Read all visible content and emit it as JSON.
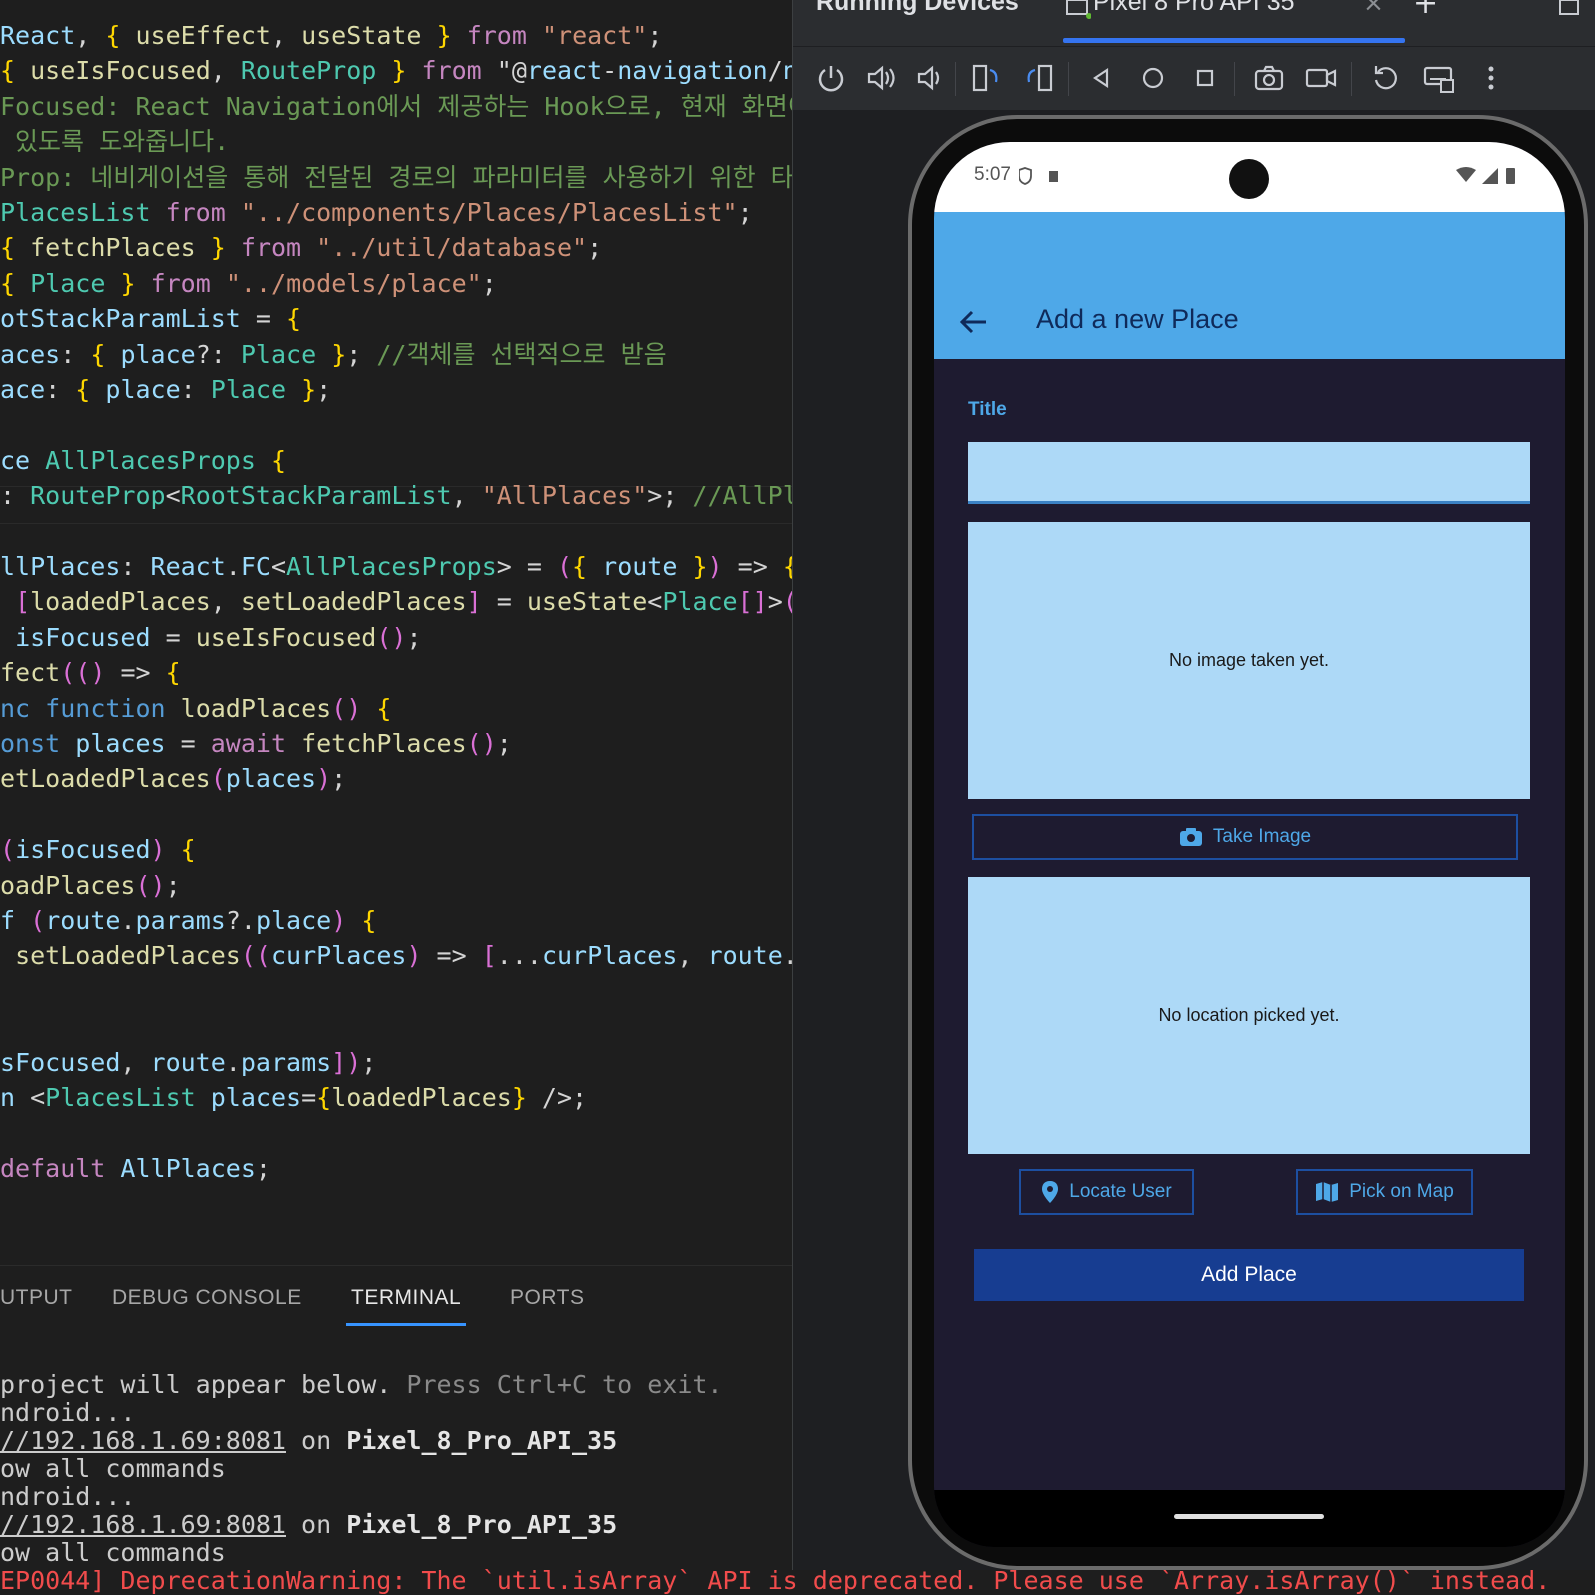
{
  "editor": {
    "lines": [
      "React, { useEffect, useState } from \"react\";",
      "{ useIsFocused, RouteProp } from \"@react-navigation/nat",
      "Focused: React Navigation에서 제공하는 Hook으로, 현재 화면이 초",
      " 있도록 도와줍니다.",
      "Prop: 네비게이션을 통해 전달된 경로의 파라미터를 사용하기 위한 타입입니",
      "PlacesList from \"../components/Places/PlacesList\";",
      "{ fetchPlaces } from \"../util/database\";",
      "{ Place } from \"../models/place\";",
      "otStackParamList = {",
      "aces: { place?: Place }; //객체를 선택적으로 받음",
      "ace: { place: Place };",
      "",
      "ce AllPlacesProps {",
      ": RouteProp<RootStackParamList, \"AllPlaces\">; //AllPlac",
      "",
      "llPlaces: React.FC<AllPlacesProps> = ({ route }) => {",
      " [loadedPlaces, setLoadedPlaces] = useState<Place[]>([]",
      " isFocused = useIsFocused();",
      "fect(() => {",
      "nc function loadPlaces() {",
      "onst places = await fetchPlaces();",
      "etLoadedPlaces(places);",
      "",
      "(isFocused) {",
      "oadPlaces();",
      "f (route.params?.place) {",
      " setLoadedPlaces((curPlaces) => [...curPlaces, route.pa",
      "",
      "",
      "sFocused, route.params]);",
      "n <PlacesList places={loadedPlaces} />;",
      "",
      "default AllPlaces;"
    ]
  },
  "panel": {
    "tabs": [
      "UTPUT",
      "DEBUG CONSOLE",
      "TERMINAL",
      "PORTS"
    ],
    "active_tab": "TERMINAL"
  },
  "terminal": {
    "line1a": "project will appear below. ",
    "line1b": "Press Ctrl+C to exit.",
    "line2": "ndroid...",
    "line3_url": "//192.168.1.69:8081",
    "line3_on": " on ",
    "line3_device": "Pixel_8_Pro_API_35",
    "line4": "ow all commands",
    "line5": "ndroid...",
    "line6_url": "//192.168.1.69:8081",
    "line6_on": " on ",
    "line6_device": "Pixel_8_Pro_API_35",
    "line7": "ow all commands",
    "line8": "EP0044] DeprecationWarning: The `util.isArray` API is deprecated. Please use `Array.isArray()` instead."
  },
  "running_devices": {
    "title": "Running Devices",
    "tab_label": "Pixel 8 Pro API 35",
    "close_glyph": "×",
    "add_glyph": "+"
  },
  "phone": {
    "status_time": "5:07",
    "appbar_title": "Add a new Place",
    "title_label": "Title",
    "title_value": "",
    "image_placeholder": "No image taken yet.",
    "take_image_label": "Take Image",
    "location_placeholder": "No location picked yet.",
    "locate_user_label": "Locate User",
    "pick_on_map_label": "Pick on Map",
    "add_place_label": "Add Place"
  },
  "colors": {
    "appbar": "#4ea8e8",
    "screen_bg": "#1e1b30",
    "preview_bg": "#add9f7",
    "primary_button": "#173d91",
    "tab_accent": "#3574f0"
  }
}
